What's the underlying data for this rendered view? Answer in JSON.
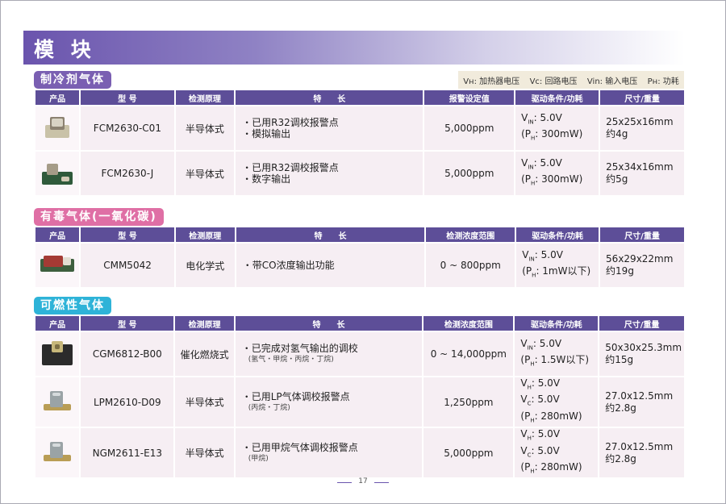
{
  "page_title": "模 块",
  "legend": {
    "vh": "Vʜ: 加热器电压",
    "vc": "Vc: 回路电压",
    "vin": "Vin: 输入电压",
    "ph": "Pʜ: 功耗"
  },
  "sections": [
    {
      "title": "制冷剂气体",
      "headers": [
        "产品",
        "型 号",
        "检测原理",
        "特　　长",
        "报警设定值",
        "驱动条件/功耗",
        "尺寸/重量"
      ],
      "rows": [
        {
          "model": "FCM2630-C01",
          "principle": "半导体式",
          "features": [
            "・已用R32调校报警点",
            "・模拟输出"
          ],
          "note": "",
          "value": "5,000ppm",
          "drive": [
            "V_IN: 5.0V",
            "(P_H: 300mW)"
          ],
          "size": [
            "25x25x16mm",
            "约4g"
          ]
        },
        {
          "model": "FCM2630-J",
          "principle": "半导体式",
          "features": [
            "・已用R32调校报警点",
            "・数字输出"
          ],
          "note": "",
          "value": "5,000ppm",
          "drive": [
            "V_IN: 5.0V",
            "(P_H: 300mW)"
          ],
          "size": [
            "25x34x16mm",
            "约5g"
          ]
        }
      ]
    },
    {
      "title": "有毒气体(一氧化碳)",
      "headers": [
        "产品",
        "型 号",
        "检测原理",
        "特　　长",
        "检测浓度范围",
        "驱动条件/功耗",
        "尺寸/重量"
      ],
      "rows": [
        {
          "model": "CMM5042",
          "principle": "电化学式",
          "features": [
            "・带CO浓度输出功能"
          ],
          "note": "",
          "value": "0 ~ 800ppm",
          "drive": [
            "V_IN: 5.0V",
            "(P_H: 1mW以下)"
          ],
          "size": [
            "56x29x22mm",
            "约19g"
          ]
        }
      ]
    },
    {
      "title": "可燃性气体",
      "headers": [
        "产品",
        "型 号",
        "检测原理",
        "特　　长",
        "检测浓度范围",
        "驱动条件/功耗",
        "尺寸/重量"
      ],
      "rows": [
        {
          "model": "CGM6812-B00",
          "principle": "催化燃烧式",
          "features": [
            "・已完成对氢气输出的调校"
          ],
          "note": "(氢气・甲烷・丙烷・丁烷)",
          "value": "0 ~ 14,000ppm",
          "drive": [
            "V_IN: 5.0V",
            "(P_H: 1.5W以下)"
          ],
          "size": [
            "50x30x25.3mm",
            "约15g"
          ]
        },
        {
          "model": "LPM2610-D09",
          "principle": "半导体式",
          "features": [
            "・已用LP气体调校报警点"
          ],
          "note": "(丙烷・丁烷)",
          "value": "1,250ppm",
          "drive": [
            "V_H: 5.0V",
            "V_C: 5.0V",
            "(P_H: 280mW)"
          ],
          "size": [
            "27.0x12.5mm",
            "约2.8g"
          ]
        },
        {
          "model": "NGM2611-E13",
          "principle": "半导体式",
          "features": [
            "・已用甲烷气体调校报警点"
          ],
          "note": "(甲烷)",
          "value": "5,000ppm",
          "drive": [
            "V_H: 5.0V",
            "V_C: 5.0V",
            "(P_H: 280mW)"
          ],
          "size": [
            "27.0x12.5mm",
            "约2.8g"
          ]
        }
      ]
    }
  ],
  "page_number": "17"
}
